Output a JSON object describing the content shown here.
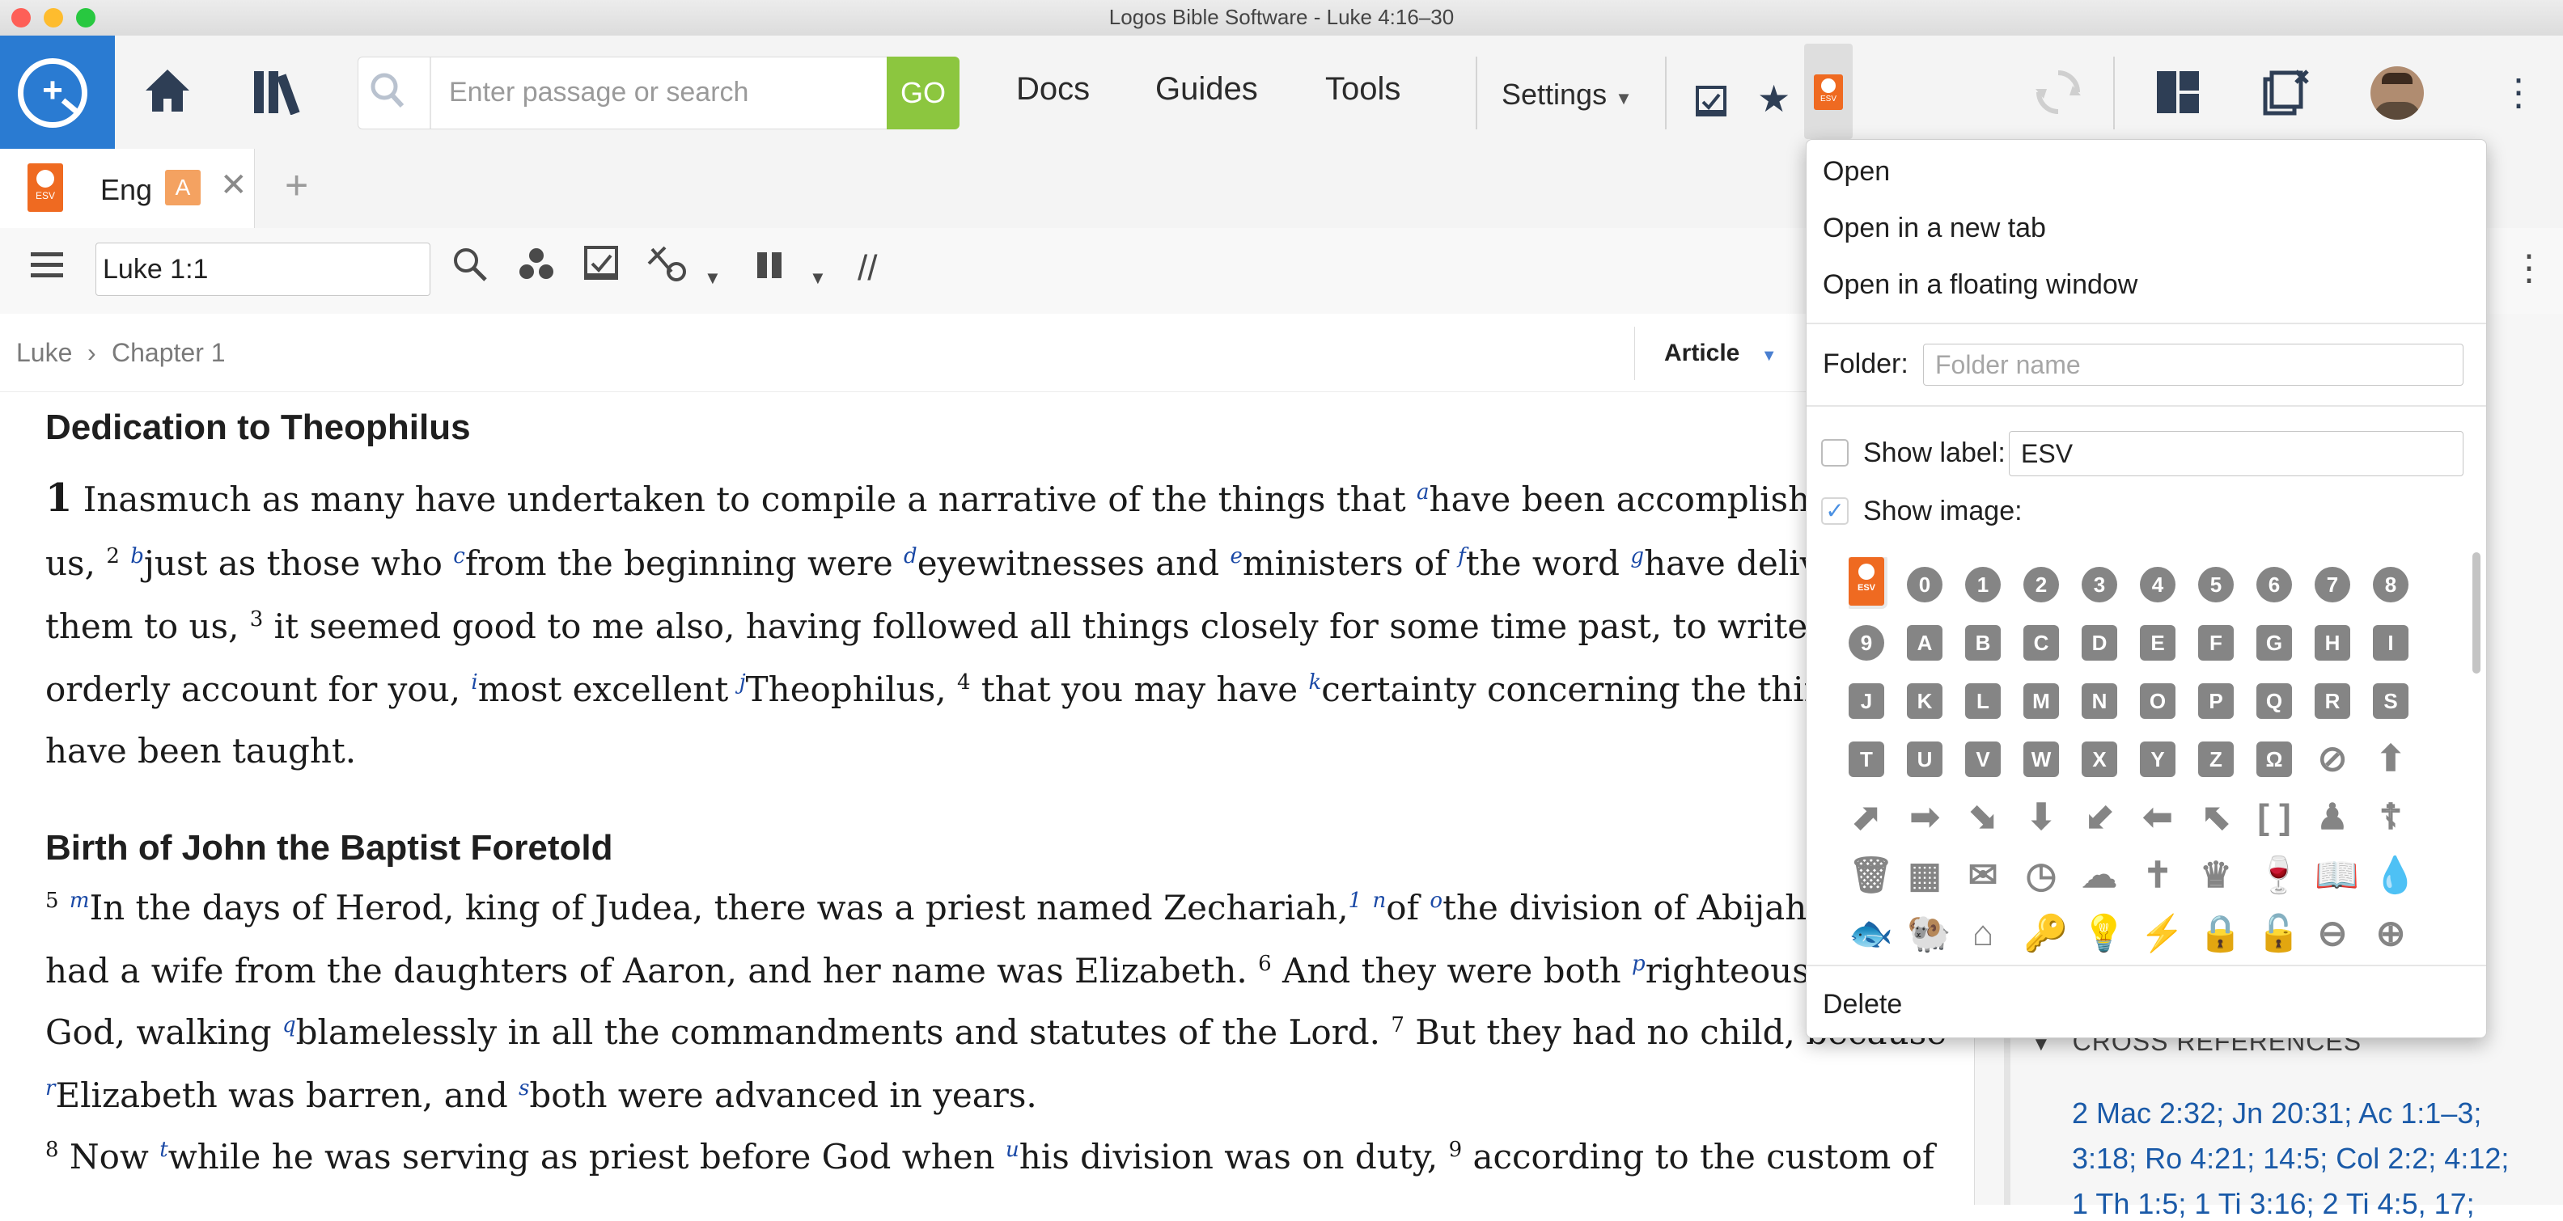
{
  "window": {
    "title": "Logos Bible Software - Luke 4:16–30"
  },
  "toolbar": {
    "search_placeholder": "Enter passage or search",
    "go_label": "GO",
    "docs": "Docs",
    "guides": "Guides",
    "tools": "Tools",
    "settings": "Settings"
  },
  "tab": {
    "label": "Eng",
    "badge": "A",
    "esv": "ESV"
  },
  "panel": {
    "reference": "Luke 1:1"
  },
  "breadcrumb": {
    "book": "Luke",
    "chapter": "Chapter 1",
    "view": "Article"
  },
  "content": {
    "heading1": "Dedication to Theophilus",
    "heading2": "Birth of John the Baptist Foretold"
  },
  "popup": {
    "open": "Open",
    "open_new_tab": "Open in a new tab",
    "open_floating": "Open in a floating window",
    "folder_label": "Folder:",
    "folder_placeholder": "Folder name",
    "show_label": "Show label:",
    "label_value": "ESV",
    "show_image": "Show image:",
    "show_label_checked": false,
    "show_image_checked": true,
    "delete": "Delete",
    "icon_rows": [
      [
        "ESV",
        "0",
        "1",
        "2",
        "3",
        "4",
        "5",
        "6",
        "7",
        "8"
      ],
      [
        "9",
        "A",
        "B",
        "C",
        "D",
        "E",
        "F",
        "G",
        "H",
        "I"
      ],
      [
        "J",
        "K",
        "L",
        "M",
        "N",
        "O",
        "P",
        "Q",
        "R",
        "S"
      ],
      [
        "T",
        "U",
        "V",
        "W",
        "X",
        "Y",
        "Z",
        "Ω",
        "⊘",
        "⬆"
      ],
      [
        "⬈",
        "➡",
        "⬊",
        "⬇",
        "⬋",
        "⬅",
        "⬉",
        "[ ]",
        "♟",
        "☦"
      ],
      [
        "🗑",
        "▦",
        "✉",
        "◷",
        "☁",
        "✝",
        "♛",
        "🍷",
        "📖",
        "💧"
      ],
      [
        "🐟",
        "🐏",
        "⌂",
        "🔑",
        "💡",
        "⚡",
        "🔒",
        "🔓",
        "⊖",
        "⊕"
      ]
    ]
  },
  "side": {
    "cross_refs_header": "CROSS REFERENCES",
    "line1": "2 Mac 2:32; Jn 20:31; Ac 1:1–3;",
    "line2": "3:18; Ro 4:21; 14:5; Col 2:2; 4:12;",
    "line3": "1 Th 1:5; 1 Ti 3:16; 2 Ti 4:5, 17;"
  },
  "colors": {
    "accent_blue": "#2a7bd2",
    "go_green": "#8cc63f",
    "esv_orange": "#ef6a21",
    "link_blue": "#1a49a6"
  }
}
